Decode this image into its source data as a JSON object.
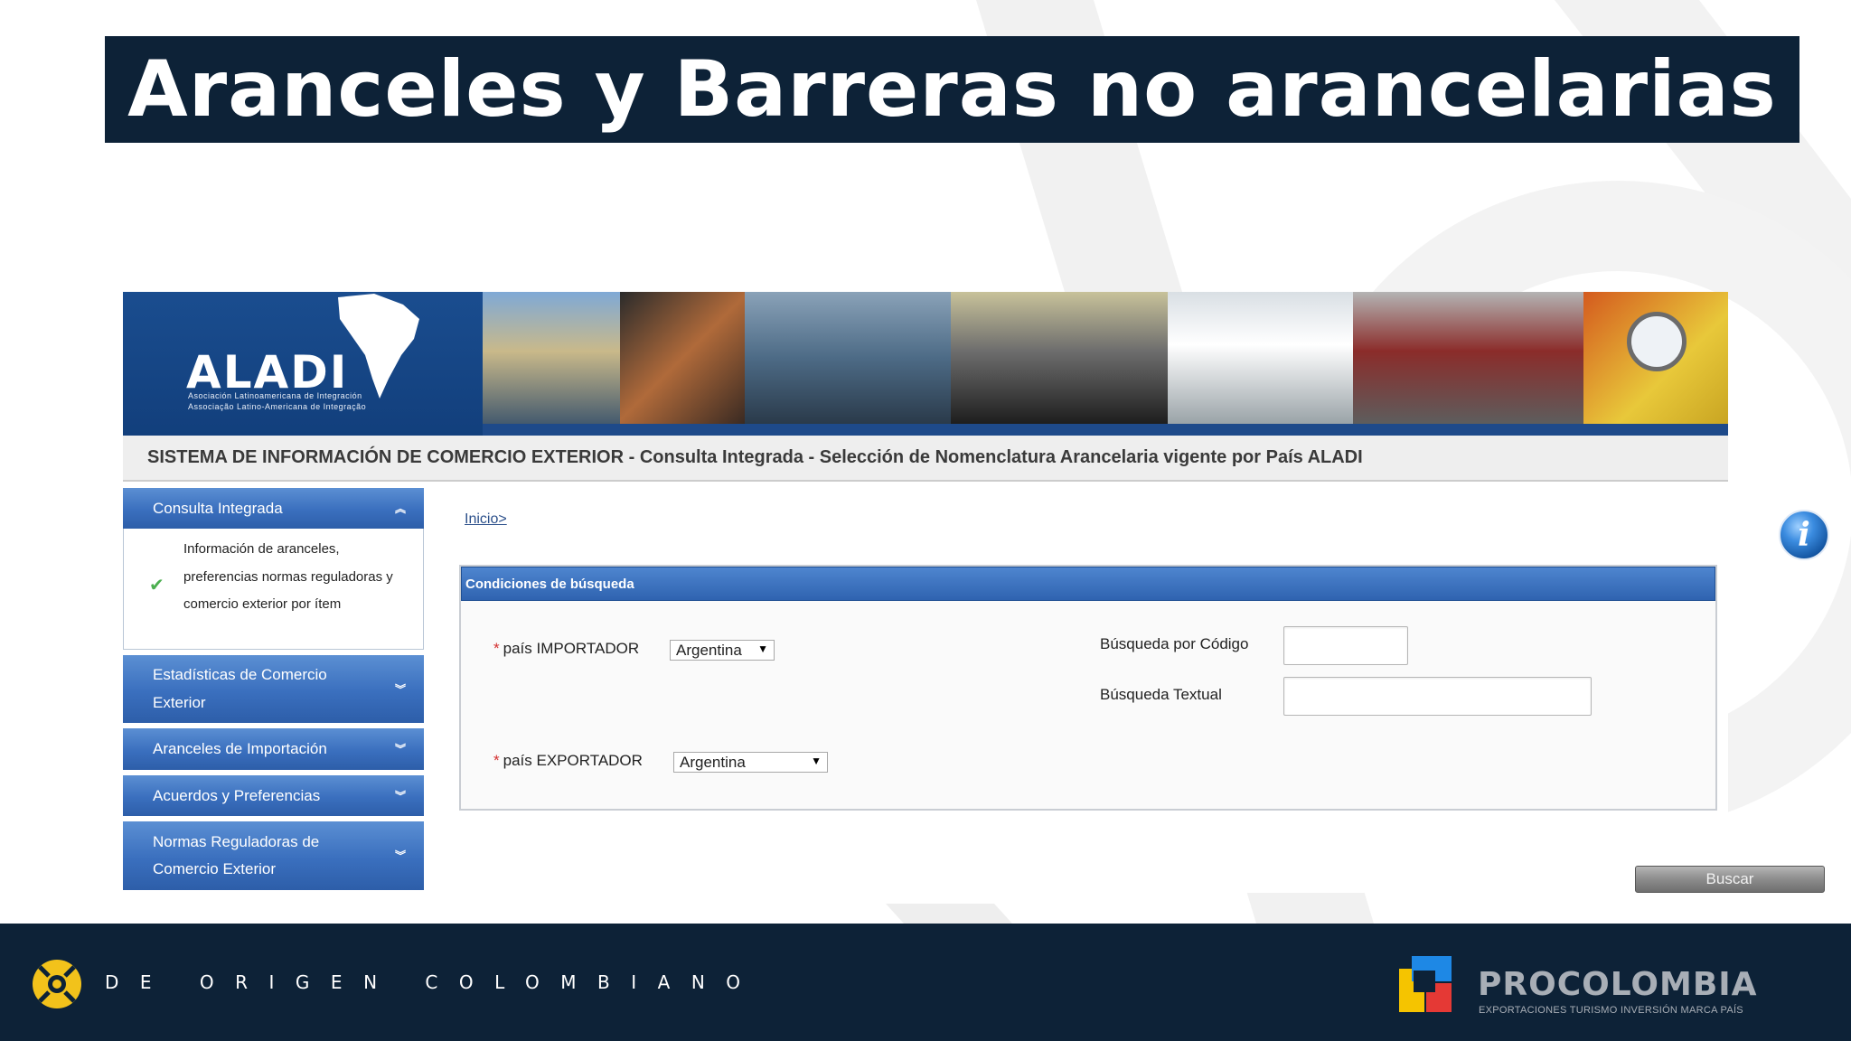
{
  "slide": {
    "title": "Aranceles y Barreras no arancelarias"
  },
  "aladi": {
    "logo": "ALADI",
    "logo_sub_1": "Asociación Latinoamericana de Integración",
    "logo_sub_2": "Associação Latino-Americana de Integração",
    "system_title": "SISTEMA DE INFORMACIÓN DE COMERCIO EXTERIOR - Consulta Integrada - Selección de Nomenclatura Arancelaria vigente por País ALADI"
  },
  "menu": {
    "items": [
      {
        "label": "Consulta Integrada",
        "expanded": true
      },
      {
        "label": "Estadísticas de Comercio Exterior",
        "expanded": false
      },
      {
        "label": "Aranceles de Importación",
        "expanded": false
      },
      {
        "label": "Acuerdos y Preferencias",
        "expanded": false
      },
      {
        "label": "Normas Reguladoras de Comercio Exterior",
        "expanded": false
      }
    ],
    "subitem": "Información de aranceles, preferencias normas reguladoras y comercio exterior por ítem"
  },
  "content": {
    "breadcrumb": "Inicio>",
    "panel_title": "Condiciones de búsqueda",
    "importer_label": "país IMPORTADOR",
    "importer_value": "Argentina",
    "exporter_label": "país EXPORTADOR",
    "exporter_value": "Argentina",
    "code_search_label": "Búsqueda por Código",
    "code_search_value": "",
    "text_search_label": "Búsqueda Textual",
    "text_search_value": "",
    "required_mark": "*",
    "search_button": "Buscar",
    "info_glyph": "i"
  },
  "footer": {
    "tagline": "DE ORIGEN COLOMBIANO",
    "brand": "PROCOLOMBIA",
    "brand_sub": "EXPORTACIONES TURISMO INVERSIÓN MARCA PAÍS"
  },
  "colors": {
    "navy": "#0d2237",
    "aladi_blue": "#14407e",
    "menu_blue": "#3a6fbe",
    "required_red": "#d32f2f"
  }
}
